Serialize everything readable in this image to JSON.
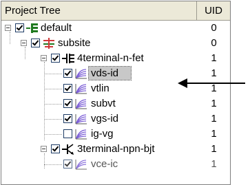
{
  "header": {
    "col_name": "Project Tree",
    "col_uid": "UID"
  },
  "rows": [
    {
      "label": "default",
      "uid": "0"
    },
    {
      "label": "subsite",
      "uid": "0"
    },
    {
      "label": "4terminal-n-fet",
      "uid": "1"
    },
    {
      "label": "vds-id",
      "uid": "1"
    },
    {
      "label": "vtlin",
      "uid": "1"
    },
    {
      "label": "subvt",
      "uid": "1"
    },
    {
      "label": "vgs-id",
      "uid": "1"
    },
    {
      "label": "ig-vg",
      "uid": "1"
    },
    {
      "label": "3terminal-npn-bjt",
      "uid": "1"
    },
    {
      "label": "vce-ic",
      "uid": "1"
    }
  ],
  "icons": {
    "project": "project-tree-root-icon",
    "site": "subsite-icon",
    "device_fet": "nfet-transistor-icon",
    "device_bjt": "npn-bjt-transistor-icon",
    "measurement": "curve-plot-icon"
  },
  "colors": {
    "selection": "#c8c8c8",
    "plot_curve": "#7a5cd6",
    "site_red": "#d03a3a",
    "tree_green": "#1f7a1f"
  }
}
